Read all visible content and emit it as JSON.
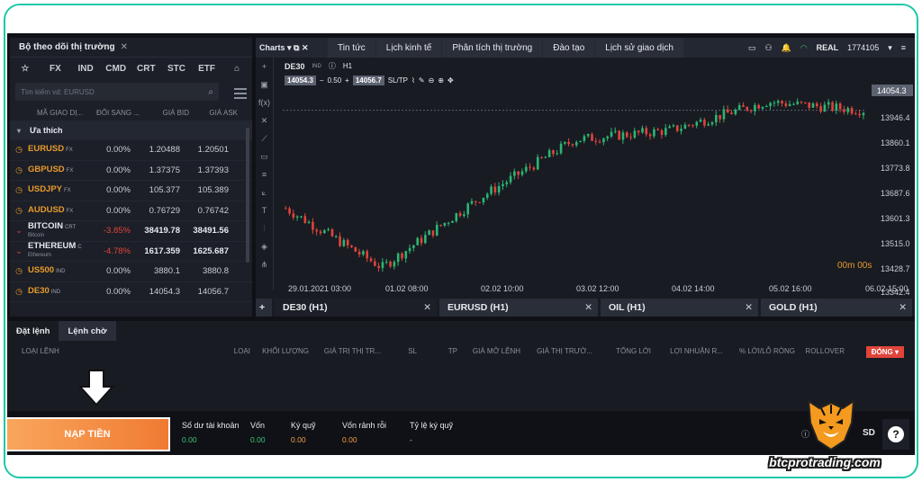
{
  "watchlist": {
    "title": "Bộ theo dõi thị trường",
    "tabs": [
      "☆",
      "FX",
      "IND",
      "CMD",
      "CRT",
      "STC",
      "ETF"
    ],
    "search_placeholder": "Tìm kiếm vd: EURUSD",
    "cols": [
      "MÃ GIAO DỊ...",
      "ĐỔI SANG ...",
      "GIÁ BID",
      "GIÁ ASK"
    ],
    "group": "Ưa thích",
    "rows": [
      {
        "sym": "EURUSD",
        "tag": "FX",
        "sub": "",
        "ch": "0.00%",
        "bid": "1.20488",
        "ask": "1.20501",
        "dn": false
      },
      {
        "sym": "GBPUSD",
        "tag": "FX",
        "sub": "",
        "ch": "0.00%",
        "bid": "1.37375",
        "ask": "1.37393",
        "dn": false
      },
      {
        "sym": "USDJPY",
        "tag": "FX",
        "sub": "",
        "ch": "0.00%",
        "bid": "105.377",
        "ask": "105.389",
        "dn": false
      },
      {
        "sym": "AUDUSD",
        "tag": "FX",
        "sub": "",
        "ch": "0.00%",
        "bid": "0.76729",
        "ask": "0.76742",
        "dn": false
      },
      {
        "sym": "BITCOIN",
        "tag": "CRT",
        "sub": "Bitcoin",
        "ch": "-3.85%",
        "bid": "38419.78",
        "ask": "38491.56",
        "dn": true
      },
      {
        "sym": "ETHEREUM",
        "tag": "C",
        "sub": "Ethereum",
        "ch": "-4.78%",
        "bid": "1617.359",
        "ask": "1625.687",
        "dn": true
      },
      {
        "sym": "US500",
        "tag": "IND",
        "sub": "",
        "ch": "0.00%",
        "bid": "3880.1",
        "ask": "3880.8",
        "dn": false
      },
      {
        "sym": "DE30",
        "tag": "IND",
        "sub": "",
        "ch": "0.00%",
        "bid": "14054.3",
        "ask": "14056.7",
        "dn": false
      }
    ]
  },
  "chart": {
    "brand": "Charts",
    "tabs": [
      "Tin tức",
      "Lịch kinh tế",
      "Phân tích thị trường",
      "Đào tạo",
      "Lịch sử giao dịch"
    ],
    "account": "REAL",
    "account_no": "1774105",
    "symbol": "DE30",
    "sym_tag": "IND",
    "tf": "H1",
    "bid": "14054.3",
    "lot": "0.50",
    "ask": "14056.7",
    "sltp": "SL/TP",
    "yticks": [
      "14054.3",
      "13946.4",
      "13860.1",
      "13773.8",
      "13687.6",
      "13601.3",
      "13515.0",
      "13428.7",
      "13342.4"
    ],
    "xticks": [
      "29.01.2021 03:00",
      "01.02 08:00",
      "02.02 10:00",
      "03.02 12:00",
      "04.02 14:00",
      "05.02 16:00",
      "06.02 15:00"
    ],
    "timer": "00m 00s",
    "bottom_tabs": [
      "DE30 (H1)",
      "EURUSD (H1)",
      "OIL (H1)",
      "GOLD (H1)"
    ]
  },
  "chart_data": {
    "type": "line",
    "x": [
      "29.01.2021 03:00",
      "01.02 08:00",
      "02.02 10:00",
      "03.02 12:00",
      "04.02 14:00",
      "05.02 16:00",
      "06.02 15:00"
    ],
    "series": [
      {
        "values": [
          13640,
          13390,
          13680,
          13930,
          13970,
          14090,
          14054
        ]
      }
    ],
    "ylim": [
      13342.4,
      14140
    ]
  },
  "orders": {
    "tabs": [
      "Đặt lệnh",
      "Lệnh chờ"
    ],
    "cols": [
      "LOẠI LỆNH",
      "LOẠI",
      "KHỐI LƯỢNG",
      "GIÁ TRỊ THỊ TR...",
      "SL",
      "TP",
      "GIÁ MỞ LỆNH",
      "GIÁ THỊ TRƯỜ...",
      "TỔNG LỜI",
      "LỢI NHUẬN R...",
      "% LỜI/LỖ RÒNG",
      "ROLLOVER"
    ],
    "close": "ĐÓNG"
  },
  "footer": {
    "deposit": "NẠP TIỀN",
    "stats": [
      {
        "l": "Số dư tài khoản",
        "v": "0.00",
        "c": "#3fc27a"
      },
      {
        "l": "Vốn",
        "v": "0.00",
        "c": "#3fc27a"
      },
      {
        "l": "Ký quỹ",
        "v": "0.00",
        "c": "#f0a040"
      },
      {
        "l": "Vốn rảnh rỗi",
        "v": "0.00",
        "c": "#f0a040"
      },
      {
        "l": "Tỷ lệ ký quỹ",
        "v": "-",
        "c": "#c9ccd3"
      }
    ],
    "currency": "SD",
    "help": "?"
  },
  "watermark": "btcprotrading.com"
}
